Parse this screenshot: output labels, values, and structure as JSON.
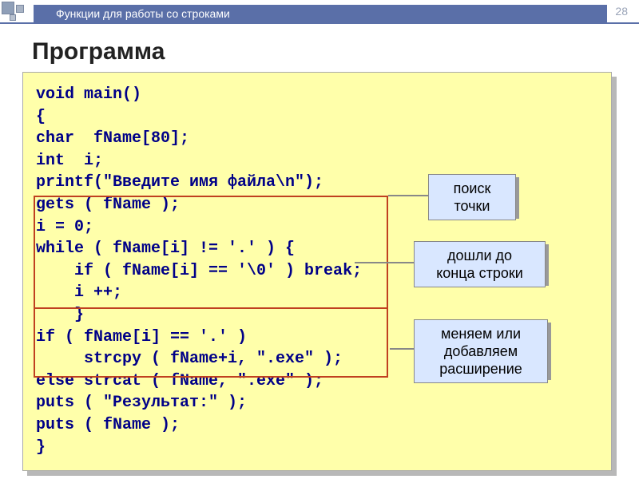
{
  "header": {
    "breadcrumb": "Функции для работы со строками",
    "page_number": "28"
  },
  "title": "Программа",
  "code": {
    "l1": "void main()",
    "l2": "{",
    "l3": "char  fName[80];",
    "l4": "int  i;",
    "l5": "printf(\"Введите имя файла\\n\");",
    "l6": "gets ( fName );",
    "l7": "i = 0;",
    "l8": "while ( fName[i] != '.' ) {",
    "l9": "    if ( fName[i] == '\\0' ) break;",
    "l10": "    i ++;",
    "l11": "    }",
    "l12": "if ( fName[i] == '.' )",
    "l13": "     strcpy ( fName+i, \".exe\" );",
    "l14": "else strcat ( fName, \".exe\" );",
    "l15": "puts ( \"Результат:\" );",
    "l16": "puts ( fName );",
    "l17": "}"
  },
  "callouts": {
    "c1_l1": "поиск",
    "c1_l2": "точки",
    "c2_l1": "дошли до",
    "c2_l2": "конца строки",
    "c3_l1": "меняем или",
    "c3_l2": "добавляем",
    "c3_l3": "расширение"
  }
}
